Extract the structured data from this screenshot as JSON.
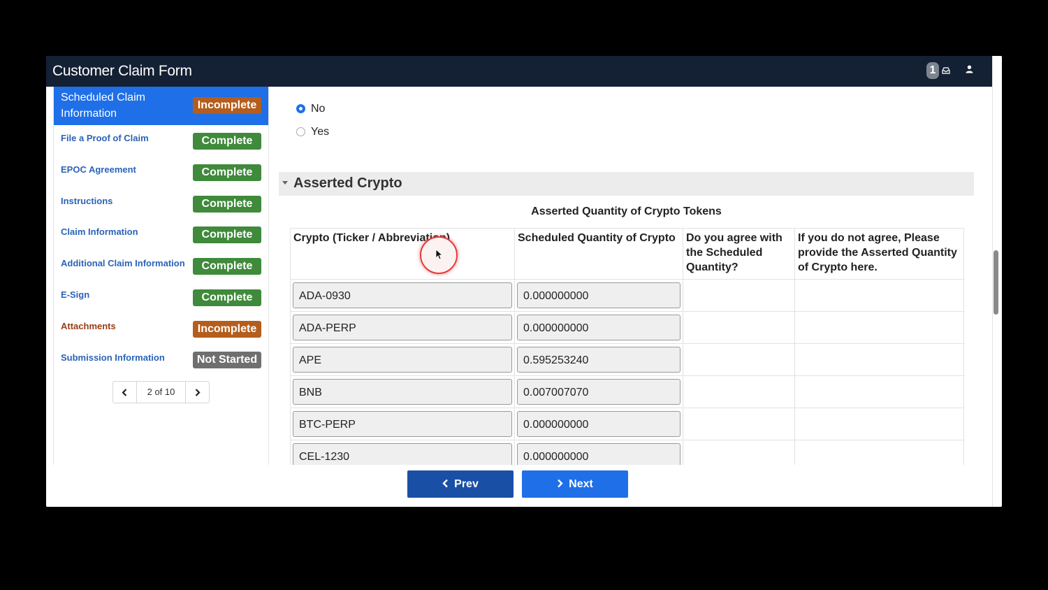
{
  "app": {
    "title": "Customer Claim Form",
    "notification_count": "1"
  },
  "sidebar": {
    "items": [
      {
        "label": "Scheduled Claim Information",
        "status": "Incomplete"
      },
      {
        "label": "File a Proof of Claim",
        "status": "Complete"
      },
      {
        "label": "EPOC Agreement",
        "status": "Complete"
      },
      {
        "label": "Instructions",
        "status": "Complete"
      },
      {
        "label": "Claim Information",
        "status": "Complete"
      },
      {
        "label": "Additional Claim Information",
        "status": "Complete"
      },
      {
        "label": "E-Sign",
        "status": "Complete"
      },
      {
        "label": "Attachments",
        "status": "Incomplete"
      },
      {
        "label": "Submission Information",
        "status": "Not Started"
      }
    ],
    "pager": {
      "text": "2 of 10"
    }
  },
  "form": {
    "radio_options": [
      {
        "label": "No",
        "selected": true
      },
      {
        "label": "Yes",
        "selected": false
      }
    ],
    "section_title": "Asserted Crypto",
    "table_title": "Asserted Quantity of Crypto Tokens",
    "columns": [
      "Crypto (Ticker / Abbreviation)",
      "Scheduled Quantity of Crypto",
      "Do you agree with the Scheduled Quantity?",
      "If you do not agree, Please provide the Asserted Quantity of Crypto here."
    ],
    "rows": [
      {
        "ticker": "ADA-0930",
        "quantity": "0.000000000"
      },
      {
        "ticker": "ADA-PERP",
        "quantity": "0.000000000"
      },
      {
        "ticker": "APE",
        "quantity": "0.595253240"
      },
      {
        "ticker": "BNB",
        "quantity": "0.007007070"
      },
      {
        "ticker": "BTC-PERP",
        "quantity": "0.000000000"
      },
      {
        "ticker": "CEL-1230",
        "quantity": "0.000000000"
      }
    ]
  },
  "footer": {
    "prev_label": "Prev",
    "next_label": "Next"
  },
  "colors": {
    "header_bg": "#142033",
    "active_nav": "#1f6fe8",
    "complete": "#3f8a3b",
    "incomplete": "#b45d1c",
    "not_started": "#6f6f6f"
  }
}
